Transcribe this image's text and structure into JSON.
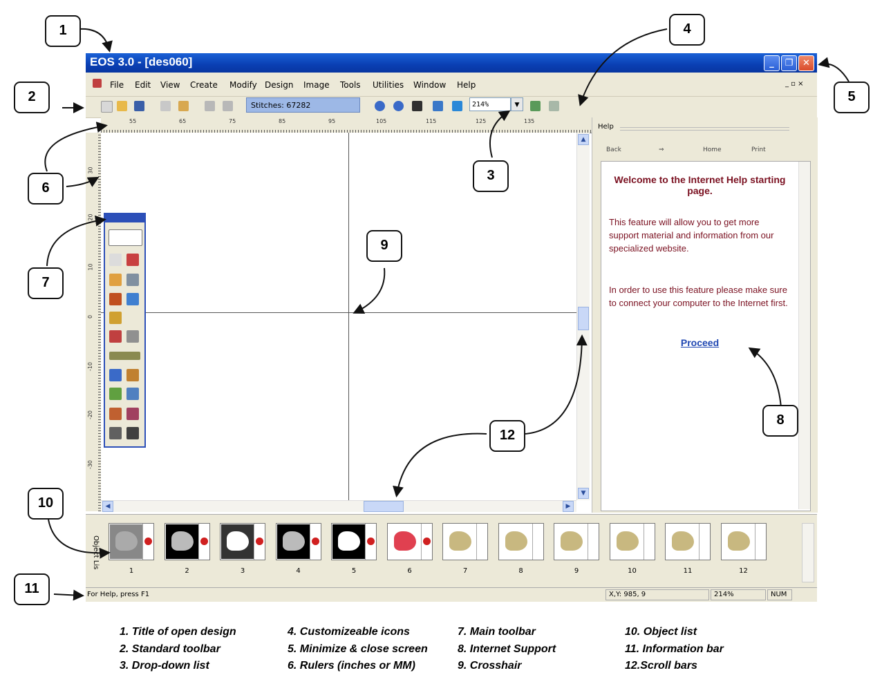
{
  "window": {
    "title": "EOS 3.0 - [des060]",
    "buttons": [
      "minimize",
      "restore",
      "close"
    ]
  },
  "menu": {
    "items": [
      "File",
      "Edit",
      "View",
      "Create",
      "Modify",
      "Design",
      "Image",
      "Tools",
      "Utilities",
      "Window",
      "Help"
    ],
    "mdi_controls": "_ ▫ ×"
  },
  "toolbar": {
    "stitches": "Stitches: 67282",
    "zoom": "214%"
  },
  "rulers": {
    "horizontal": [
      "55",
      "65",
      "75",
      "85",
      "95",
      "105",
      "115",
      "125",
      "135"
    ],
    "vertical": [
      "30",
      "20",
      "10",
      "0",
      "-10",
      "-20",
      "-30"
    ]
  },
  "help": {
    "pane_title": "Help",
    "back": "Back",
    "forward": "⇒",
    "home": "Home",
    "print": "Print",
    "title": "Welcome to the Internet Help starting page.",
    "para1": "This feature will allow you to get more support material and information from our specialized website.",
    "para2": "In order to use this feature please make sure to connect your computer to the Internet first.",
    "link": "Proceed"
  },
  "object_list": {
    "label": "Object Lis",
    "items": [
      "1",
      "2",
      "3",
      "4",
      "5",
      "6",
      "7",
      "8",
      "9",
      "10",
      "11",
      "12"
    ]
  },
  "status": {
    "help": "For Help, press F1",
    "coords": "X,Y:  985, 9",
    "zoom": "214%",
    "num": "NUM"
  },
  "callouts": [
    "1",
    "2",
    "3",
    "4",
    "5",
    "6",
    "7",
    "8",
    "9",
    "10",
    "11",
    "12"
  ],
  "legend": {
    "col1": [
      "1. Title of open design",
      "2. Standard toolbar",
      "3. Drop-down list"
    ],
    "col2": [
      "4. Customizeable icons",
      "5. Minimize & close screen",
      "6. Rulers (inches or MM)"
    ],
    "col3": [
      "7. Main  toolbar",
      "8. Internet Support",
      "9. Crosshair"
    ],
    "col4": [
      "10. Object list",
      "11. Information bar",
      "12.Scroll bars"
    ]
  }
}
